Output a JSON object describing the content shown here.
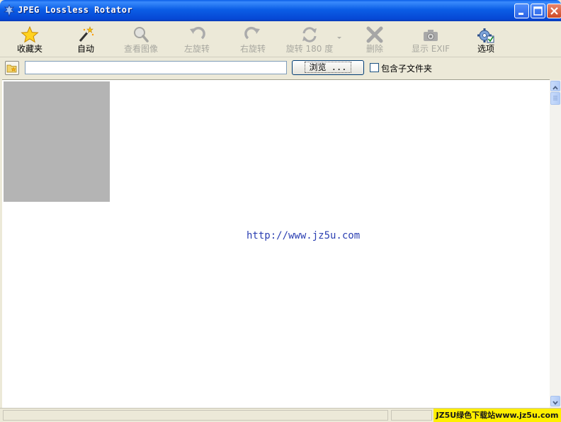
{
  "window": {
    "title": "JPEG Lossless Rotator"
  },
  "toolbar": {
    "items": [
      {
        "label": "收藏夹",
        "icon": "star-icon",
        "enabled": true
      },
      {
        "label": "自动",
        "icon": "magic-wand-icon",
        "enabled": true
      },
      {
        "label": "查看图像",
        "icon": "magnifier-icon",
        "enabled": false
      },
      {
        "label": "左旋转",
        "icon": "rotate-left-icon",
        "enabled": false
      },
      {
        "label": "右旋转",
        "icon": "rotate-right-icon",
        "enabled": false
      },
      {
        "label": "旋转 180 度",
        "icon": "rotate-180-icon",
        "enabled": false
      },
      {
        "label": "删除",
        "icon": "delete-x-icon",
        "enabled": false
      },
      {
        "label": "显示 EXIF",
        "icon": "camera-icon",
        "enabled": false
      },
      {
        "label": "选项",
        "icon": "options-gear-icon",
        "enabled": true
      }
    ]
  },
  "pathbar": {
    "path_value": "",
    "browse_label": "浏览 ...",
    "include_subfolders_label": "包含子文件夹",
    "include_subfolders_checked": false
  },
  "content": {
    "link_text": "http://www.jz5u.com"
  },
  "statusbar": {
    "watermark_text": "JZ5U绿色下载站www.jz5u.com"
  },
  "colors": {
    "titlebar_blue": "#0b5ee6",
    "link_blue": "#2b3fb2",
    "watermark_yellow": "#ffef00",
    "close_red": "#cf4a24"
  }
}
